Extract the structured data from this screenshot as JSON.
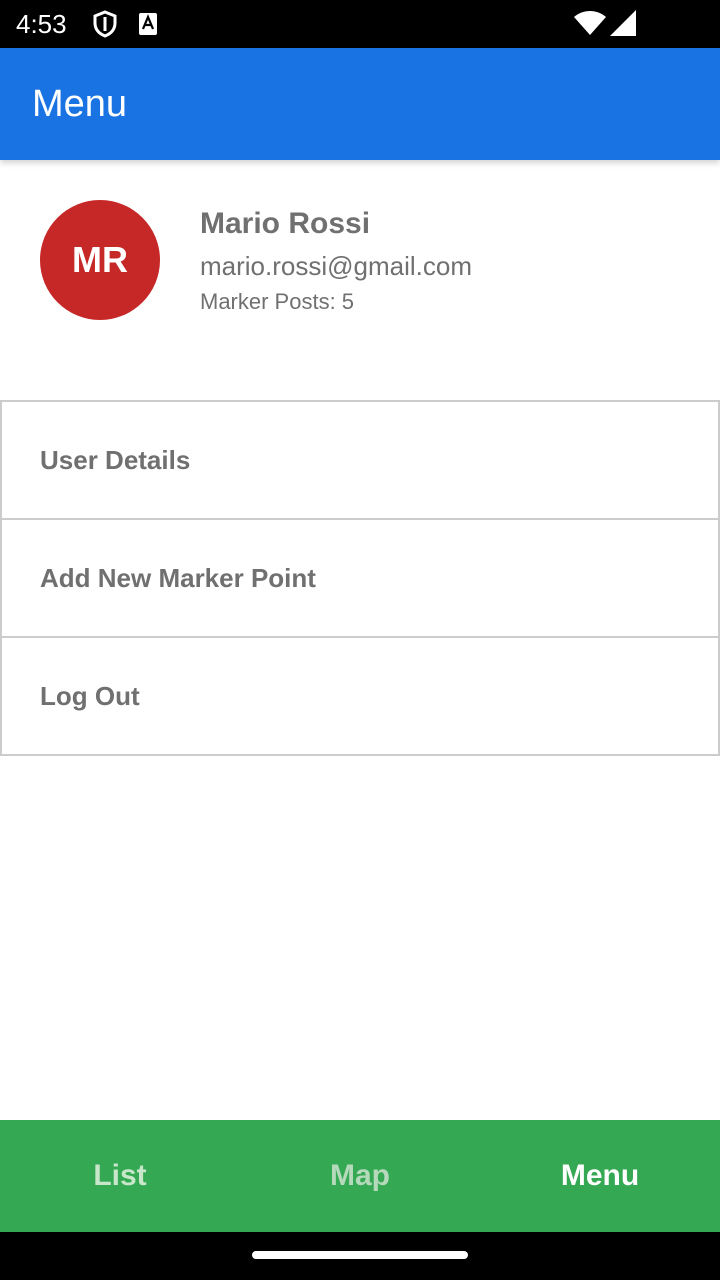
{
  "status_bar": {
    "time": "4:53",
    "icons": [
      "shield-icon",
      "accessibility-a-icon",
      "wifi-icon",
      "signal-icon"
    ]
  },
  "app_bar": {
    "title": "Menu",
    "color": "#1a73e3"
  },
  "profile": {
    "initials": "MR",
    "avatar_color": "#c62828",
    "name": "Mario Rossi",
    "email": "mario.rossi@gmail.com",
    "posts": "Marker Posts: 5"
  },
  "menu": {
    "items": [
      {
        "label": "User Details"
      },
      {
        "label": "Add New Marker Point"
      },
      {
        "label": "Log Out"
      }
    ]
  },
  "bottom_nav": {
    "color": "#34a853",
    "tabs": [
      {
        "label": "List",
        "active": false
      },
      {
        "label": "Map",
        "active": false
      },
      {
        "label": "Menu",
        "active": true
      }
    ]
  }
}
